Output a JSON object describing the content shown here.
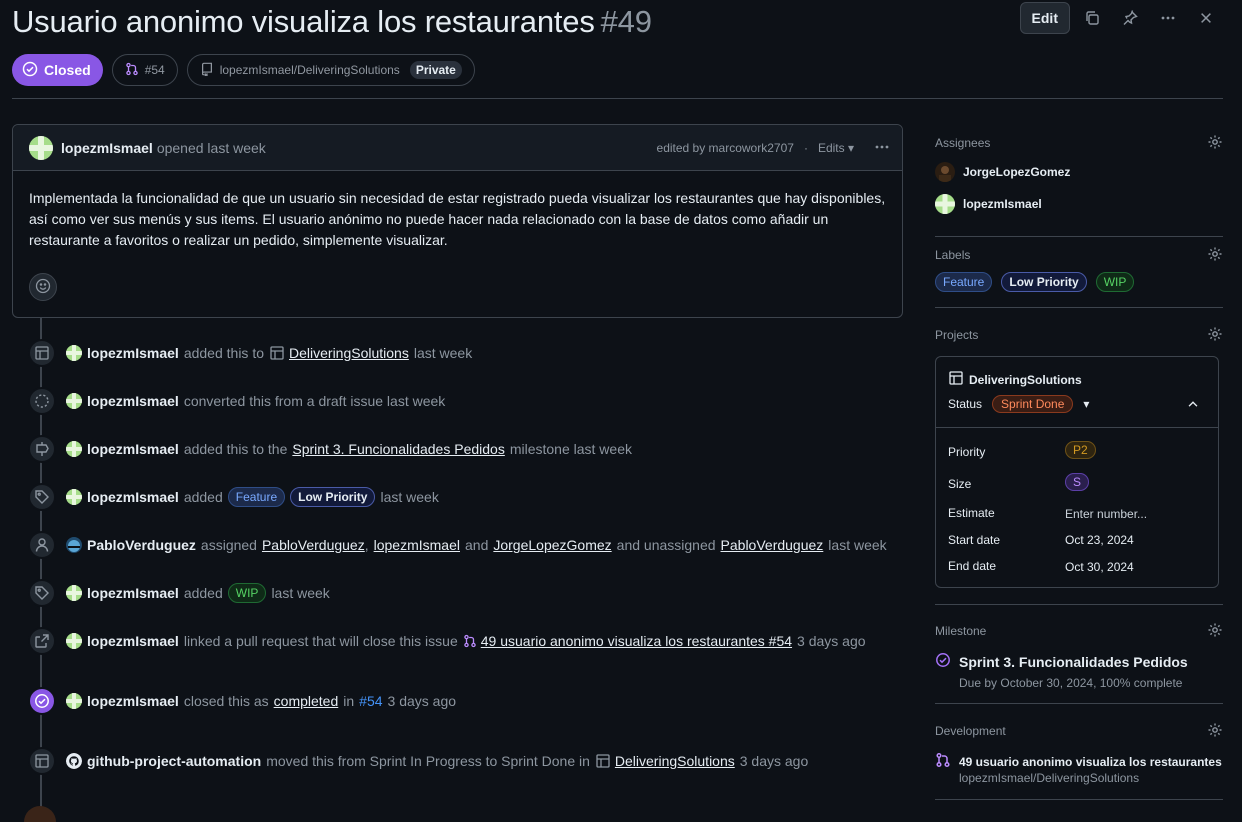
{
  "header": {
    "title": "Usuario anonimo visualiza los restaurantes",
    "number": "#49",
    "edit_label": "Edit",
    "state": "Closed",
    "linked_pr": "#54",
    "repo": "lopezmIsmael/DeliveringSolutions",
    "visibility": "Private"
  },
  "comment": {
    "author": "lopezmIsmael",
    "timestamp": "opened last week",
    "edited_by": "edited by marcowork2707",
    "edits_label": "Edits",
    "body": "Implementada la funcionalidad de que un usuario sin necesidad de estar registrado pueda visualizar los restaurantes que hay disponibles, así como ver sus menús y sus items. El usuario anónimo no puede hacer nada relacionado con la base de datos como añadir un restaurante a favoritos o realizar un pedido, simplemente visualizar."
  },
  "timeline": [
    {
      "who": "lopezmIsmael",
      "a": "added this to",
      "link": "DeliveringSolutions",
      "b": "last week"
    },
    {
      "who": "lopezmIsmael",
      "a": "converted this from a draft issue last week"
    },
    {
      "who": "lopezmIsmael",
      "a": "added this to the",
      "link": "Sprint 3. Funcionalidades Pedidos",
      "b": "milestone last week"
    },
    {
      "who": "lopezmIsmael",
      "a": "added",
      "label1": "Feature",
      "label2": "Low Priority",
      "b": "last week"
    },
    {
      "who": "PabloVerduguez",
      "a": "assigned",
      "link1": "PabloVerduguez",
      "comma": ",",
      "link2": "lopezmIsmael",
      "and": "and",
      "link3": "JorgeLopezGomez",
      "b": "and unassigned",
      "link4": "PabloVerduguez",
      "c": "last week"
    },
    {
      "who": "lopezmIsmael",
      "a": "added",
      "label1": "WIP",
      "b": "last week"
    },
    {
      "who": "lopezmIsmael",
      "a": "linked a pull request that will close this issue",
      "link": "49 usuario anonimo visualiza los restaurantes #54",
      "b": "3 days ago"
    },
    {
      "who": "lopezmIsmael",
      "a": "closed this as",
      "link": "completed",
      "in": "in",
      "pr": "#54",
      "b": "3 days ago"
    },
    {
      "who": "github-project-automation",
      "a": "moved this from Sprint In Progress to Sprint Done in",
      "link": "DeliveringSolutions",
      "b": "3 days ago"
    }
  ],
  "sidebar": {
    "assignees_title": "Assignees",
    "assignees": [
      "JorgeLopezGomez",
      "lopezmIsmael"
    ],
    "labels_title": "Labels",
    "labels": [
      "Feature",
      "Low Priority",
      "WIP"
    ],
    "projects_title": "Projects",
    "project": {
      "name": "DeliveringSolutions",
      "status_key": "Status",
      "status": "Sprint Done",
      "fields": [
        {
          "key": "Priority",
          "value": "P2"
        },
        {
          "key": "Size",
          "value": "S"
        },
        {
          "key": "Estimate",
          "value": "Enter number..."
        },
        {
          "key": "Start date",
          "value": "Oct 23, 2024"
        },
        {
          "key": "End date",
          "value": "Oct 30, 2024"
        }
      ]
    },
    "milestone_title": "Milestone",
    "milestone": "Sprint 3. Funcionalidades Pedidos",
    "milestone_due": "Due by October 30, 2024, 100% complete",
    "development_title": "Development",
    "development_pr": "49 usuario anonimo visualiza los restaurantes",
    "development_repo": "lopezmIsmael/DeliveringSolutions"
  },
  "colors": {
    "background": "#0d1117",
    "closed_purple": "#8957e5",
    "link_blue": "#4493f8"
  }
}
